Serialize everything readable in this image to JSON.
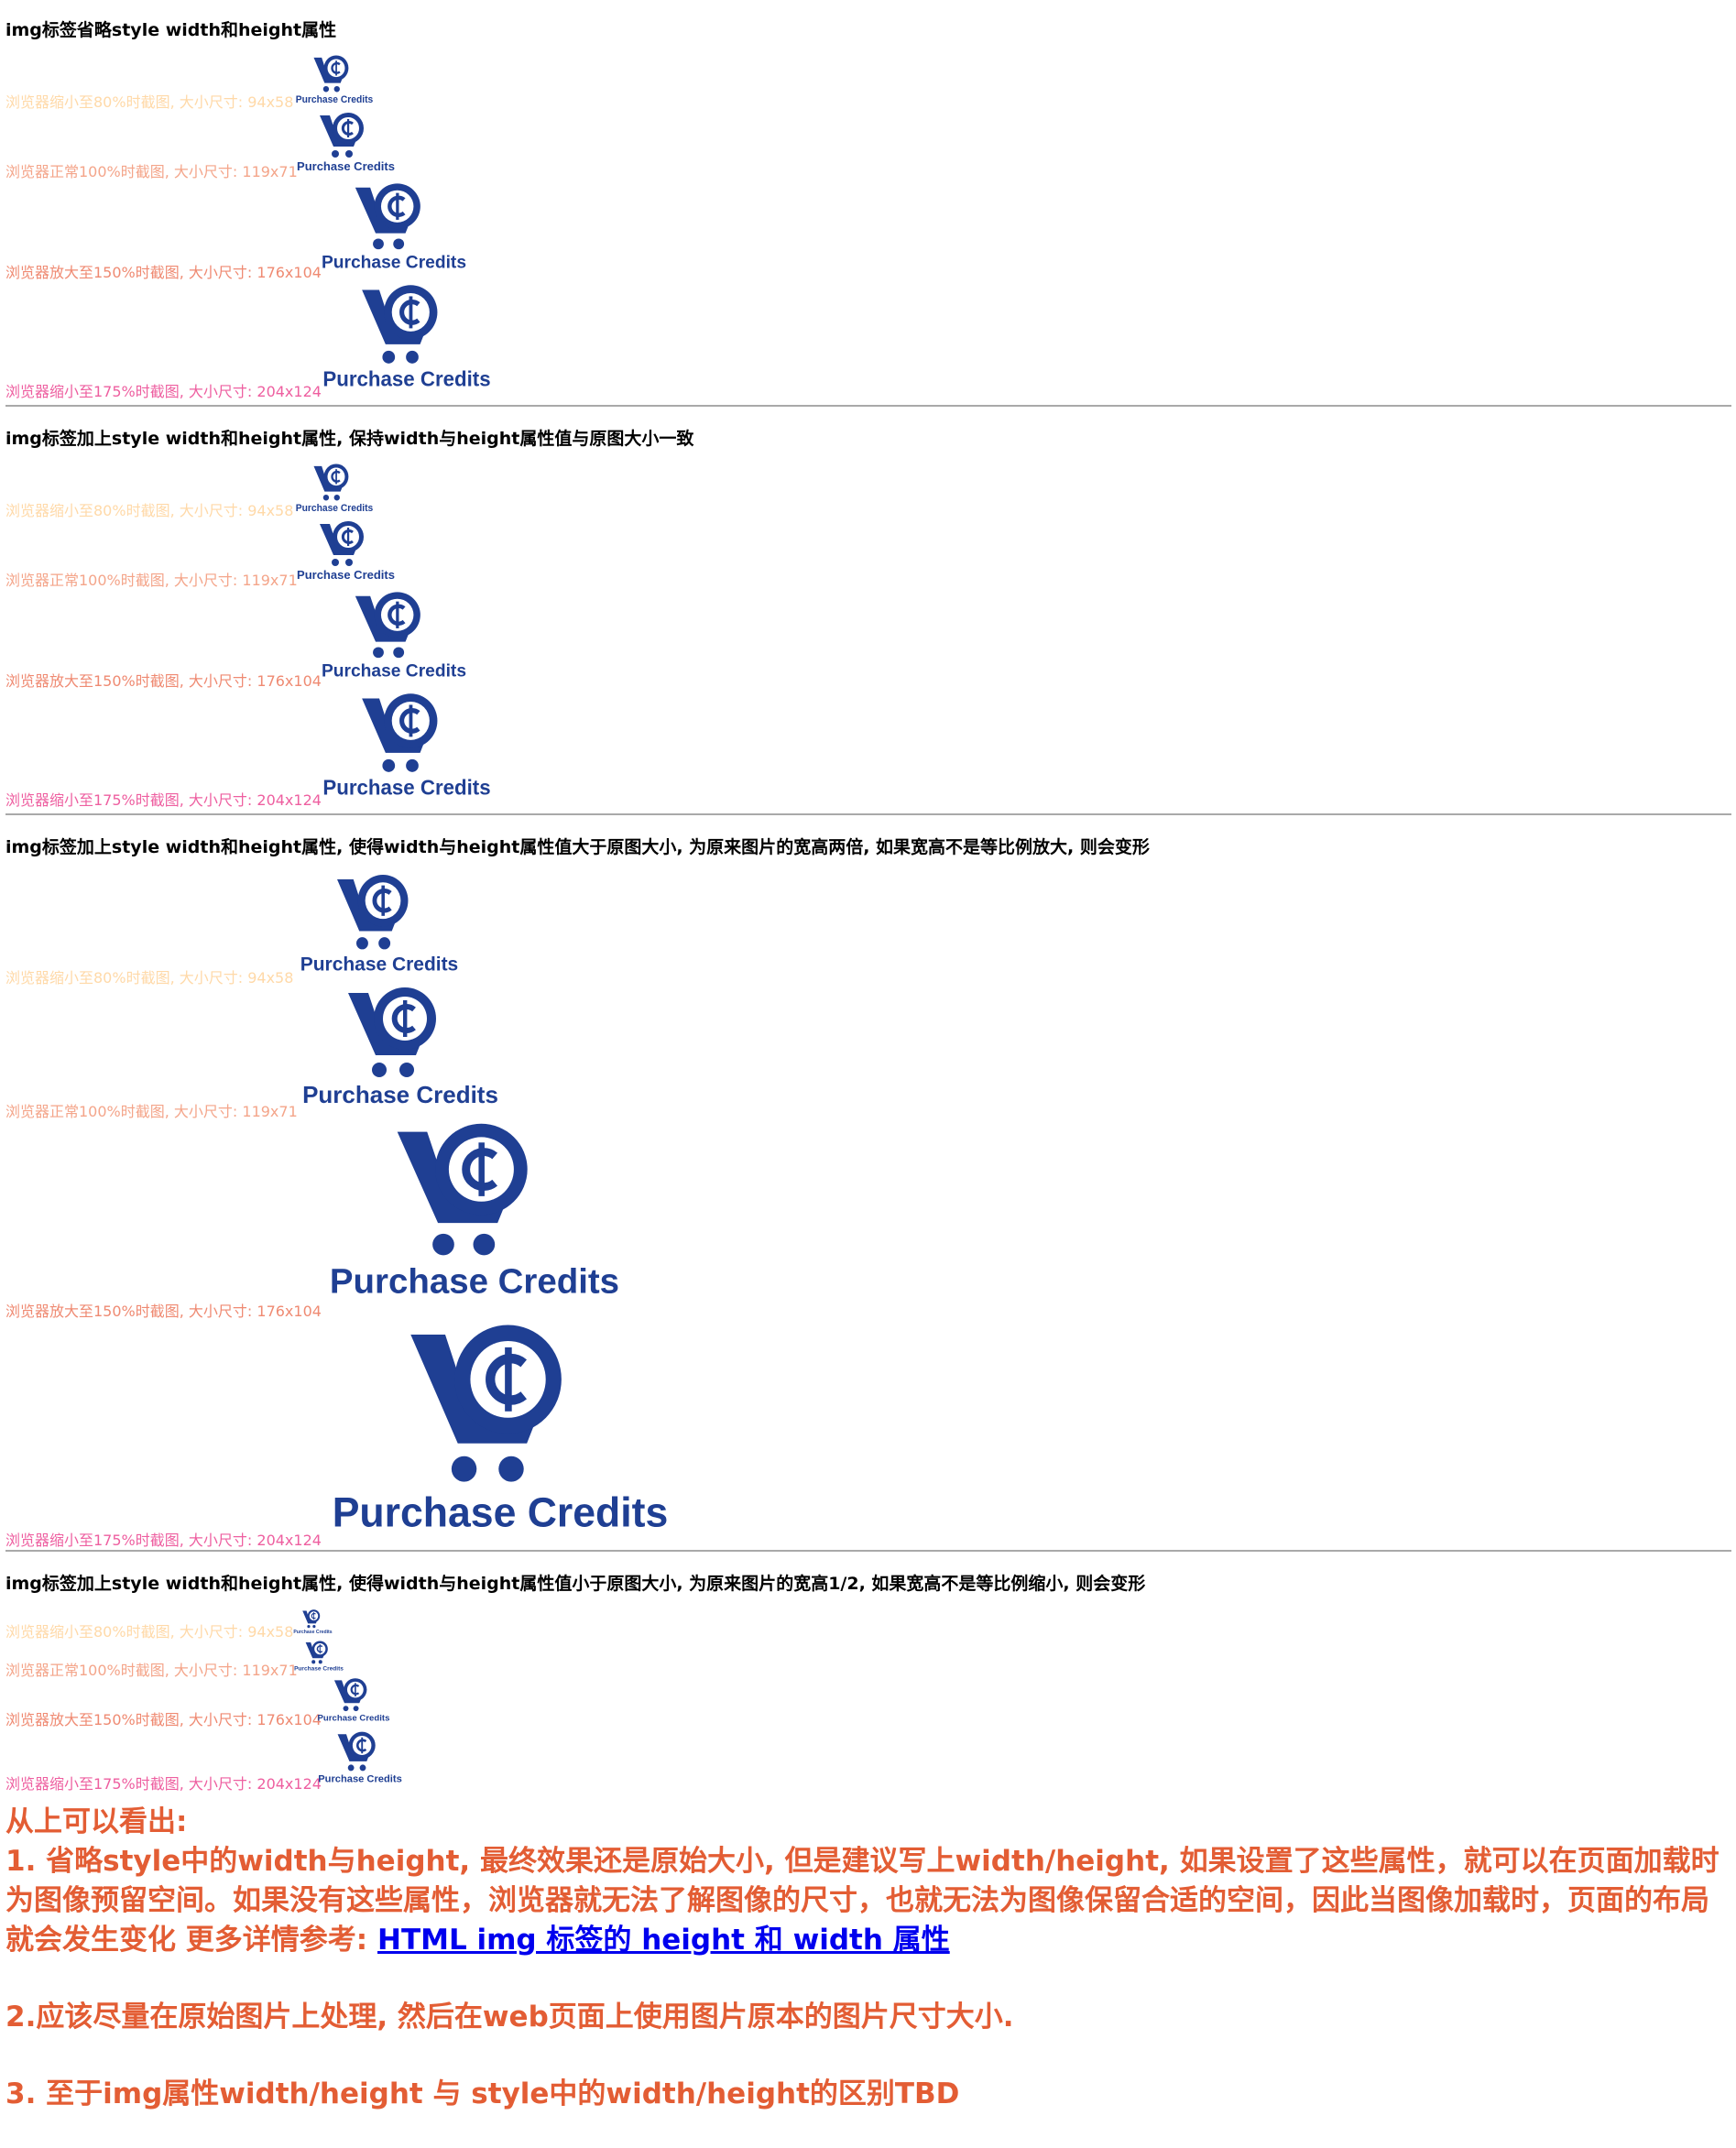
{
  "sections": [
    {
      "title": "img标签省略style width和height属性",
      "rows": [
        {
          "caption": "浏览器缩小至80%时截图, 大小尺寸: 94x58",
          "image_label": "Purchase Credits"
        },
        {
          "caption": "浏览器正常100%时截图, 大小尺寸: 119x71",
          "image_label": "Purchase Credits"
        },
        {
          "caption": "浏览器放大至150%时截图, 大小尺寸: 176x104",
          "image_label": "Purchase Credits"
        },
        {
          "caption": "浏览器缩小至175%时截图, 大小尺寸: 204x124",
          "image_label": "Purchase Credits"
        }
      ]
    },
    {
      "title": "img标签加上style width和height属性, 保持width与height属性值与原图大小一致",
      "rows": [
        {
          "caption": "浏览器缩小至80%时截图, 大小尺寸: 94x58",
          "image_label": "Purchase Credits"
        },
        {
          "caption": "浏览器正常100%时截图, 大小尺寸: 119x71",
          "image_label": "Purchase Credits"
        },
        {
          "caption": "浏览器放大至150%时截图, 大小尺寸: 176x104",
          "image_label": "Purchase Credits"
        },
        {
          "caption": "浏览器缩小至175%时截图, 大小尺寸: 204x124",
          "image_label": "Purchase Credits"
        }
      ]
    },
    {
      "title": "img标签加上style width和height属性, 使得width与height属性值大于原图大小, 为原来图片的宽高两倍, 如果宽高不是等比例放大, 则会变形",
      "rows": [
        {
          "caption": "浏览器缩小至80%时截图, 大小尺寸: 94x58",
          "image_label": "Purchase Credits"
        },
        {
          "caption": "浏览器正常100%时截图, 大小尺寸: 119x71",
          "image_label": "Purchase Credits"
        },
        {
          "caption": "浏览器放大至150%时截图, 大小尺寸: 176x104",
          "image_label": "Purchase Credits"
        },
        {
          "caption": "浏览器缩小至175%时截图, 大小尺寸: 204x124",
          "image_label": "Purchase Credits"
        }
      ]
    },
    {
      "title": "img标签加上style width和height属性, 使得width与height属性值小于原图大小, 为原来图片的宽高1/2, 如果宽高不是等比例缩小, 则会变形",
      "rows": [
        {
          "caption": "浏览器缩小至80%时截图, 大小尺寸: 94x58",
          "image_label": "Purchase Credits"
        },
        {
          "caption": "浏览器正常100%时截图, 大小尺寸: 119x71",
          "image_label": "Purchase Credits"
        },
        {
          "caption": "浏览器放大至150%时截图, 大小尺寸: 176x104",
          "image_label": "Purchase Credits"
        },
        {
          "caption": "浏览器缩小至175%时截图, 大小尺寸: 204x124",
          "image_label": "Purchase Credits"
        }
      ]
    }
  ],
  "summary": {
    "heading": "从上可以看出:",
    "point1": "1. 省略style中的width与height, 最终效果还是原始大小, 但是建议写上width/height, 如果设置了这些属性，就可以在页面加载时为图像预留空间。如果没有这些属性，浏览器就无法了解图像的尺寸，也就无法为图像保留合适的空间，因此当图像加载时，页面的布局就会发生变化 更多详情参考:",
    "link_text": "HTML img 标签的 height 和 width 属性",
    "point2": "2.应该尽量在原始图片上处理, 然后在web页面上使用图片原本的图片尺寸大小.",
    "point3": "3. 至于img属性width/height 与 style中的width/height的区别TBD"
  },
  "colors": {
    "logo_blue": "#1f3f93",
    "summary_orange": "#e35d34",
    "link_blue": "#0000ee",
    "caption_80": "#ffd9a8",
    "caption_100": "#f4a58a",
    "caption_150": "#ef8a72",
    "caption_175": "#ee5fa0"
  },
  "icons": [
    "shopping-cart-cent-icon"
  ]
}
